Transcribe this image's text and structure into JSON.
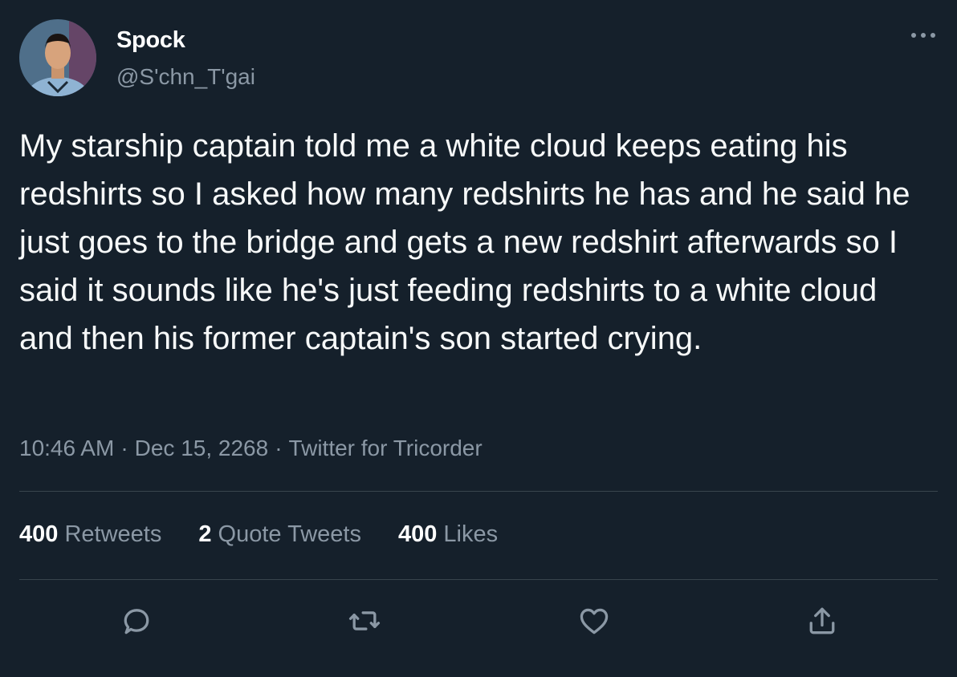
{
  "author": {
    "display_name": "Spock",
    "handle": "@S'chn_T'gai",
    "avatar_icon": "avatar-photo"
  },
  "tweet": {
    "text": "My starship captain told me a white cloud keeps eating his redshirts so I asked how many redshirts he has and he said he just goes to the bridge and gets a new redshirt afterwards so I said it sounds like he's just feeding redshirts to a white cloud and then his former captain's son started crying.",
    "time": "10:46 AM",
    "date": "Dec 15, 2268",
    "source": "Twitter for Tricorder",
    "separator": "·"
  },
  "stats": {
    "retweets": {
      "count": "400",
      "label": "Retweets"
    },
    "quotes": {
      "count": "2",
      "label": "Quote Tweets"
    },
    "likes": {
      "count": "400",
      "label": "Likes"
    }
  },
  "actions": [
    "reply-icon",
    "retweet-icon",
    "like-icon",
    "share-icon"
  ],
  "colors": {
    "background": "#15202b",
    "text": "#f7f9f9",
    "secondary": "#8b98a5",
    "divider": "#38444d"
  }
}
